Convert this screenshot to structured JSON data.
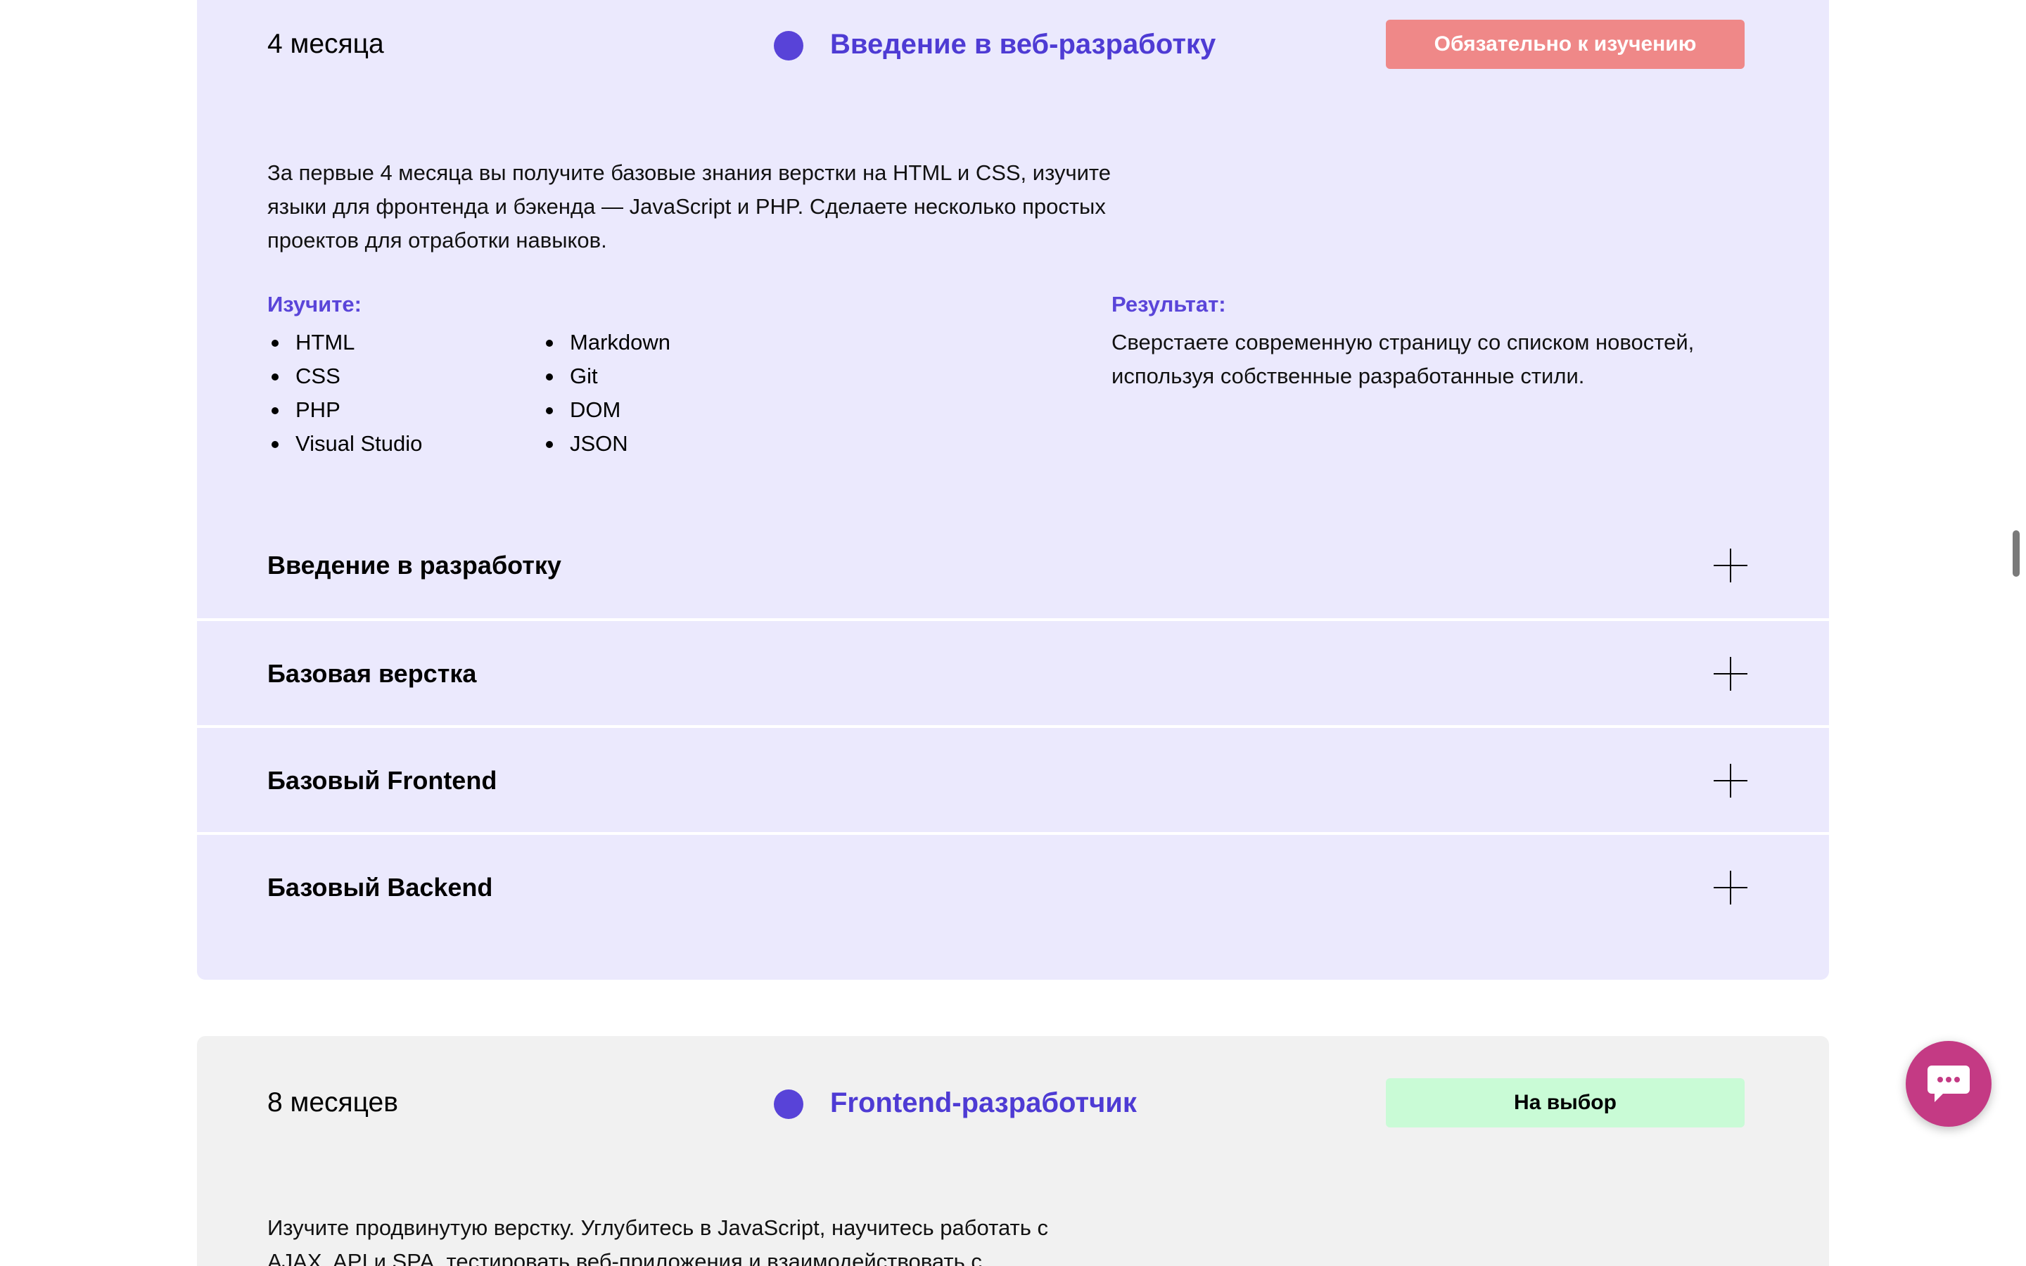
{
  "tracks": [
    {
      "duration": "4 месяца",
      "title": "Введение в веб-разработку",
      "badge": "Обязательно к изучению",
      "description": "За первые 4 месяца вы получите базовые знания верстки на HTML и CSS, изучите языки для фронтенда и бэкенда — JavaScript и PHP. Сделаете несколько простых проектов для отработки навыков.",
      "learn_label": "Изучите:",
      "learn_col_1": [
        "HTML",
        "CSS",
        "PHP",
        "Visual Studio"
      ],
      "learn_col_2": [
        "Markdown",
        "Git",
        "DOM",
        "JSON"
      ],
      "result_label": "Результат:",
      "result_text": "Сверстаете современную страницу со списком новостей, используя собственные разработанные стили.",
      "modules": [
        "Введение в разработку",
        "Базовая верстка",
        "Базовый Frontend",
        "Базовый Backend"
      ]
    },
    {
      "duration": "8 месяцев",
      "title": "Frontend-разработчик",
      "badge": "На выбор",
      "description": "Изучите продвинутую верстку. Углубитесь в JavaScript, научитесь работать с AJAX, API и SPA, тестировать веб-приложения и взаимодействовать с"
    }
  ],
  "colors": {
    "accent": "#5843d8",
    "card_required_bg": "#ebe9fd",
    "card_optional_bg": "#f1f1f1",
    "badge_required": "#ef8888",
    "badge_optional": "#c9fbd6",
    "chat_button": "#c43a84"
  },
  "icons": {
    "expand": "plus-icon",
    "chat": "chat-bubble-icon"
  }
}
